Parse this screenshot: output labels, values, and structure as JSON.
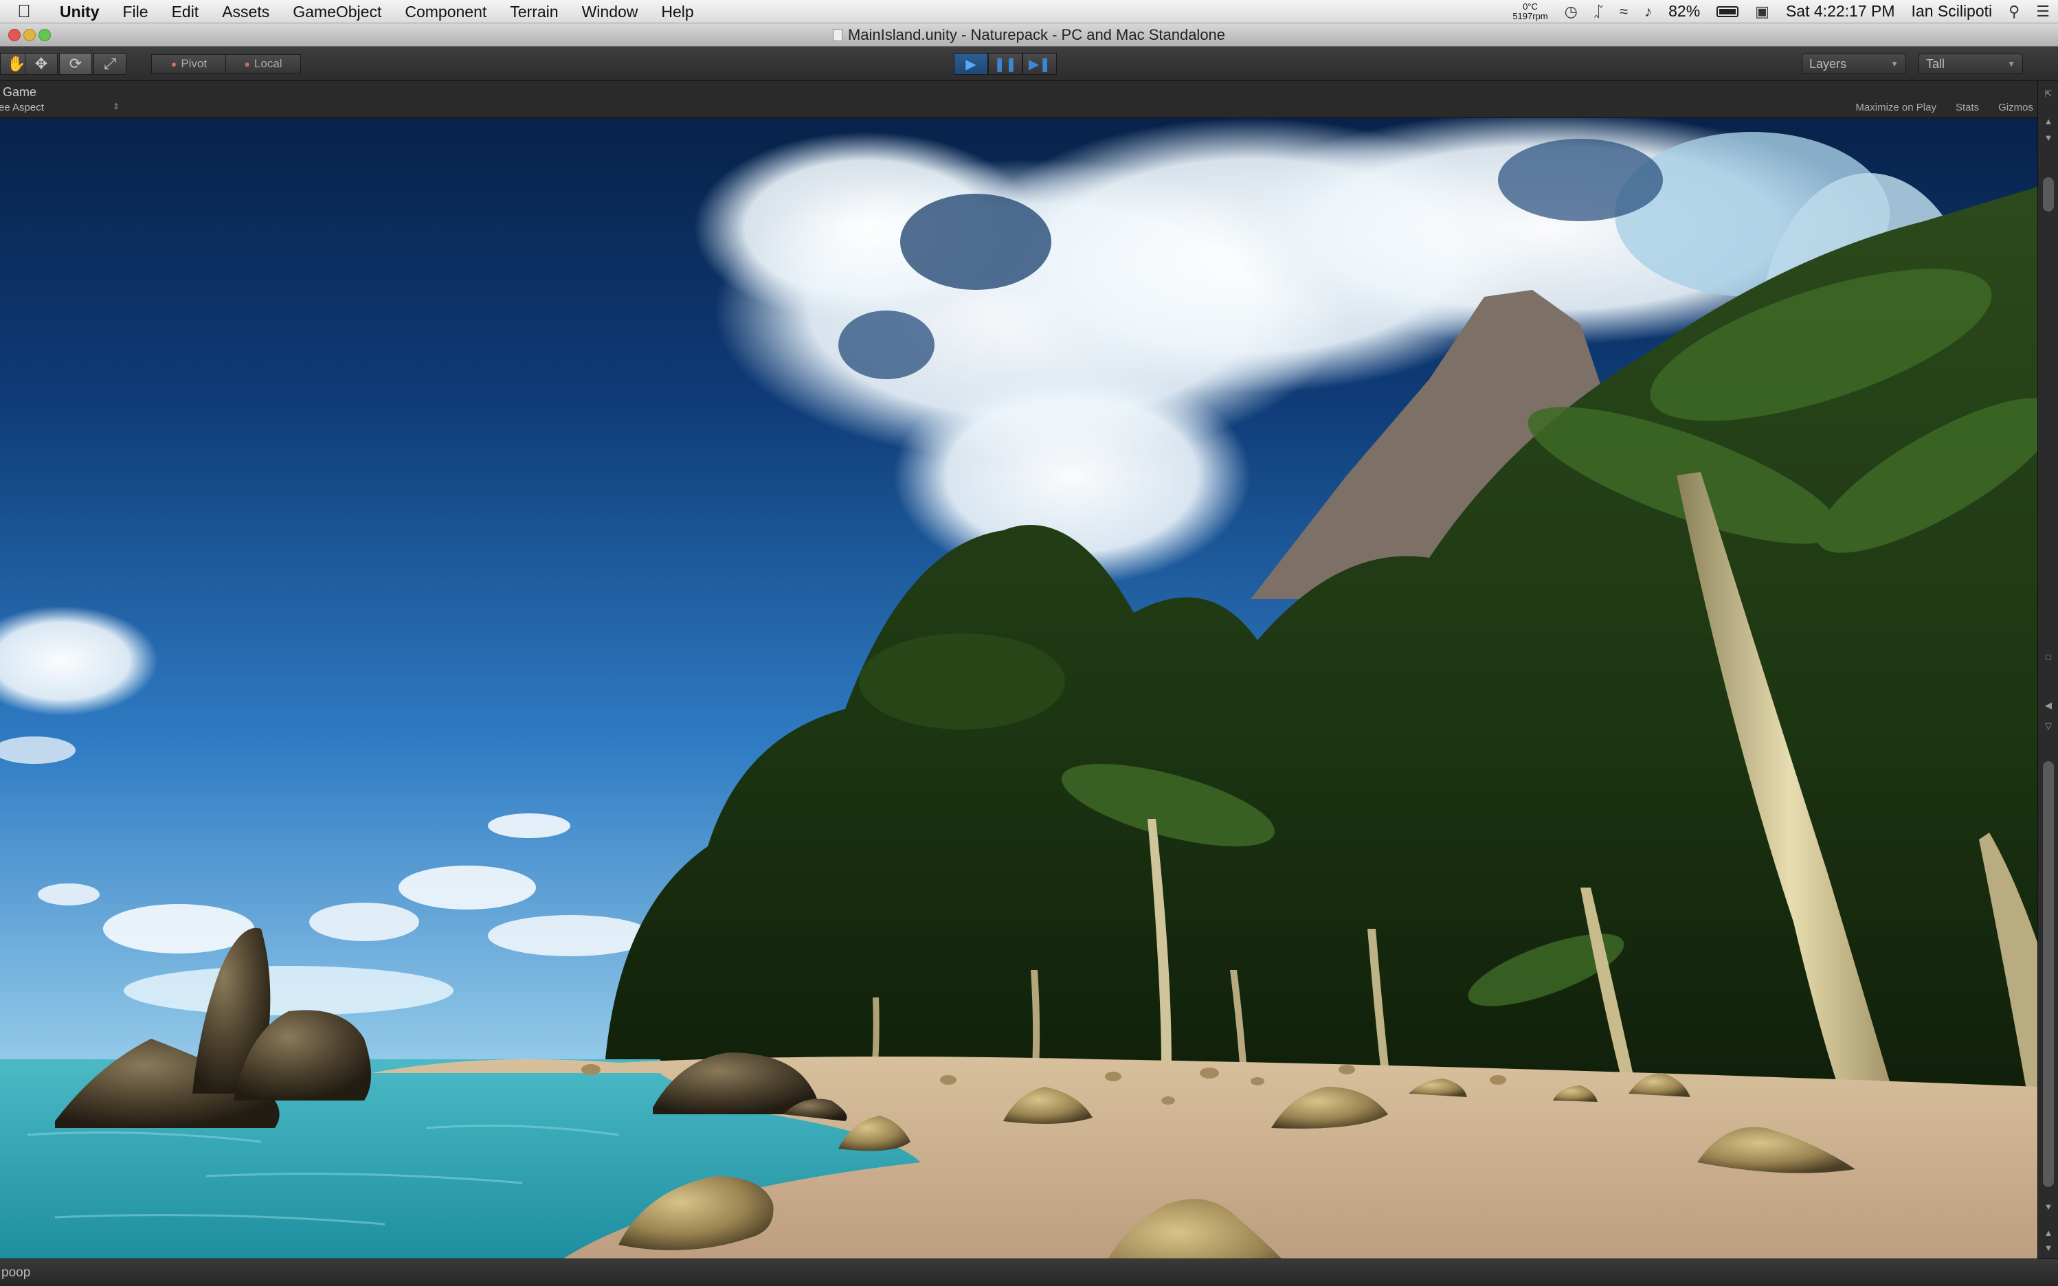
{
  "menubar": {
    "apple_icon": "apple-logo-icon",
    "items": [
      "Unity",
      "File",
      "Edit",
      "Assets",
      "GameObject",
      "Component",
      "Terrain",
      "Window",
      "Help"
    ],
    "temperature": "0°C",
    "fan": "5197rpm",
    "battery": "82%",
    "clock": "Sat 4:22:17 PM",
    "user": "Ian Scilipoti"
  },
  "window": {
    "title": "MainIsland.unity - Naturepack - PC and Mac Standalone"
  },
  "toolbar": {
    "pivot": "Pivot",
    "local": "Local",
    "layers": "Layers",
    "layout": "Tall"
  },
  "game_view": {
    "tab": "Game",
    "aspect": "ee Aspect",
    "maximize_on_play": "Maximize on Play",
    "stats": "Stats",
    "gizmos": "Gizmos"
  },
  "status": {
    "message": "poop"
  },
  "colors": {
    "play_active": "#2d5e92",
    "toolbar_bg": "#333333",
    "sky_top": "#08224a",
    "water": "#3ab7c4",
    "sand": "#c8a886"
  }
}
